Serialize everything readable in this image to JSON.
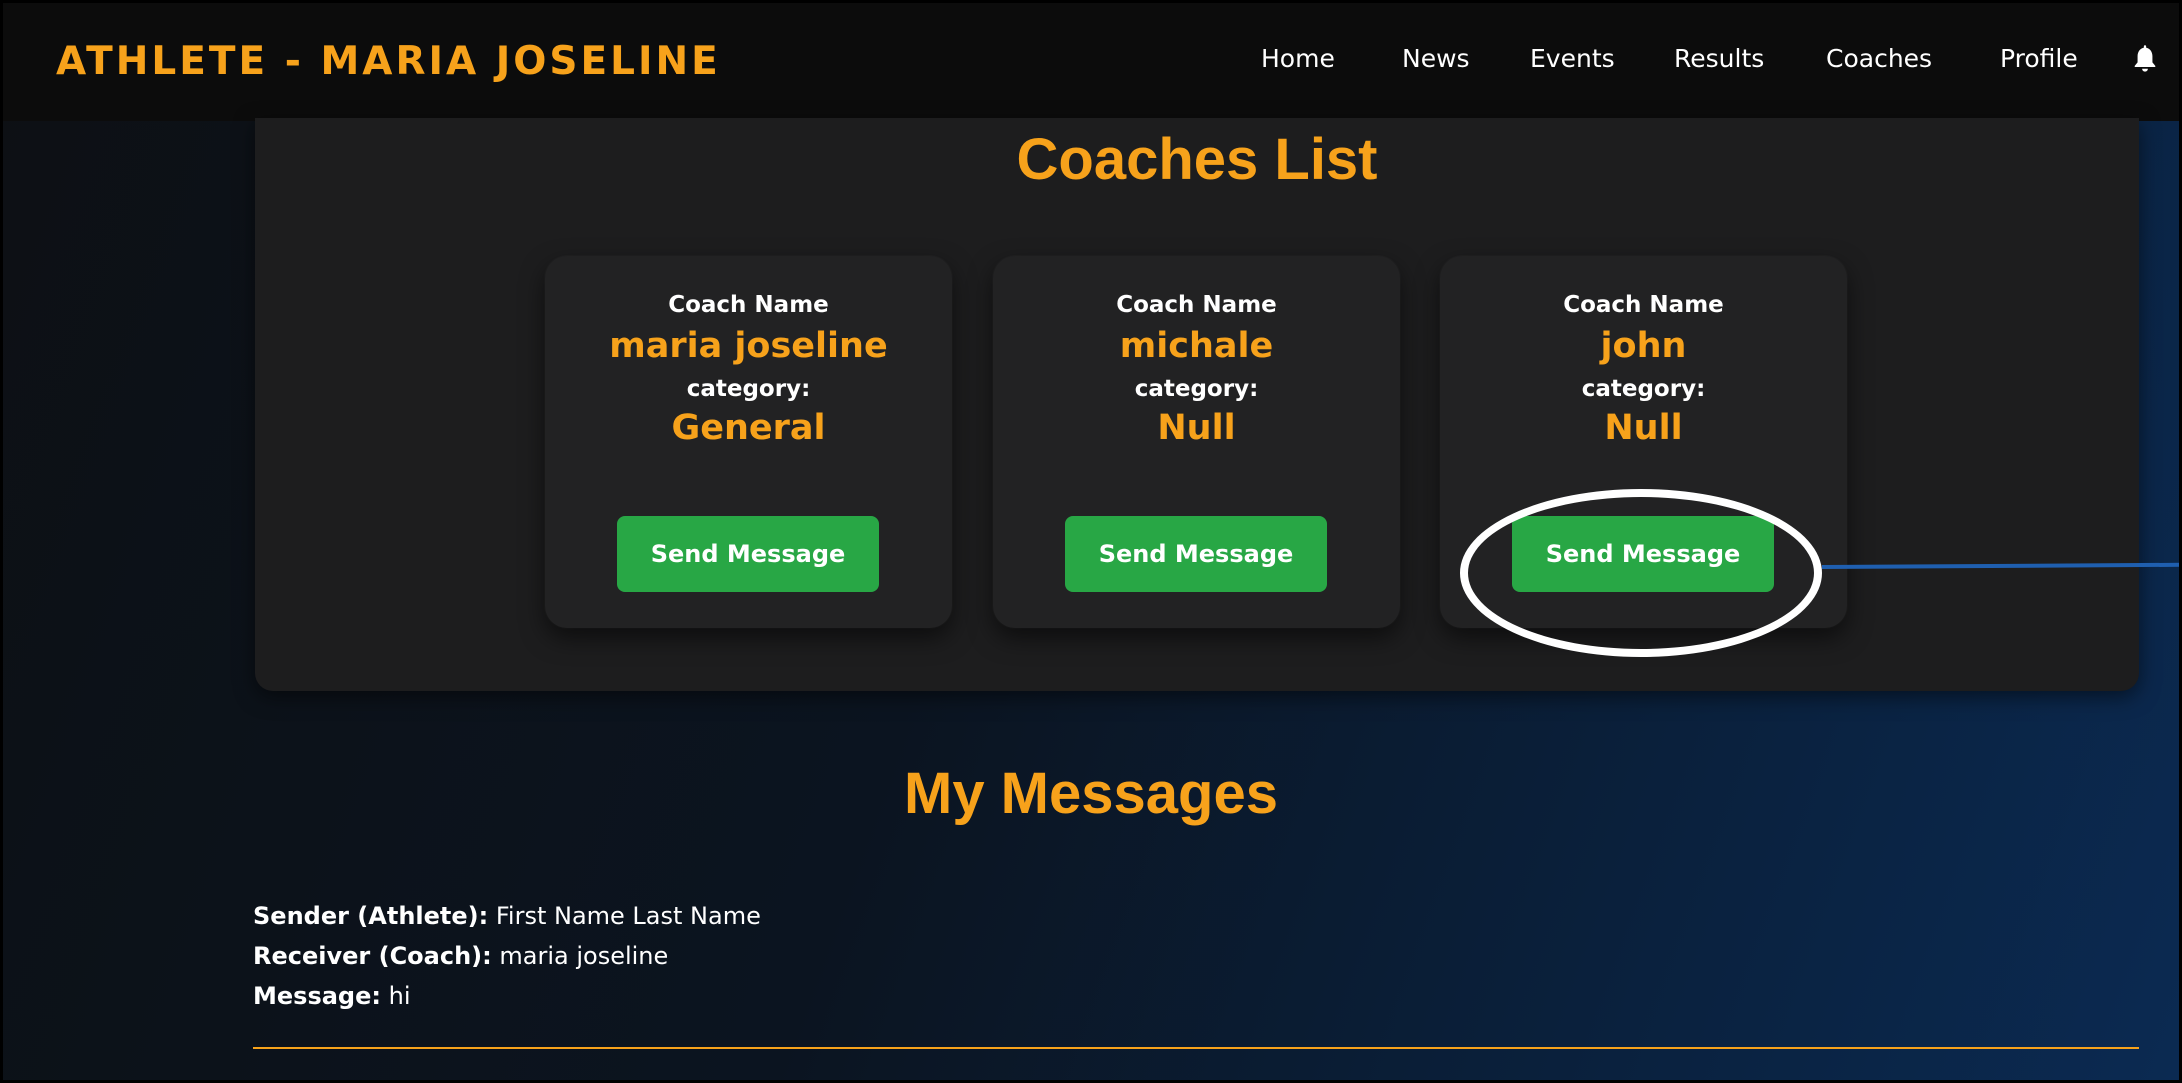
{
  "navbar": {
    "brand": "ATHLETE - MARIA JOSELINE",
    "links": [
      "Home",
      "News",
      "Events",
      "Results",
      "Coaches",
      "Profile"
    ],
    "bell_icon": "bell-icon"
  },
  "coaches": {
    "title": "Coaches List",
    "cards": [
      {
        "name_label": "Coach Name",
        "name": "maria joseline",
        "category_label": "category:",
        "category": "General",
        "button": "Send Message"
      },
      {
        "name_label": "Coach Name",
        "name": "michale",
        "category_label": "category:",
        "category": "Null",
        "button": "Send Message"
      },
      {
        "name_label": "Coach Name",
        "name": "john",
        "category_label": "category:",
        "category": "Null",
        "button": "Send Message"
      }
    ]
  },
  "messages": {
    "title": "My Messages",
    "entries": [
      {
        "sender_label": "Sender (Athlete):",
        "sender": "First Name Last Name",
        "receiver_label": "Receiver (Coach):",
        "receiver": "maria joseline",
        "message_label": "Message:",
        "message": "hi"
      }
    ]
  },
  "colors": {
    "accent": "#f7a21b",
    "button": "#28a745",
    "navbar_bg": "#0c0c0c",
    "panel_bg": "#1d1d1e",
    "card_bg": "#222223",
    "annotation": "#ffffff",
    "annotation_line": "#1f5fb0"
  }
}
